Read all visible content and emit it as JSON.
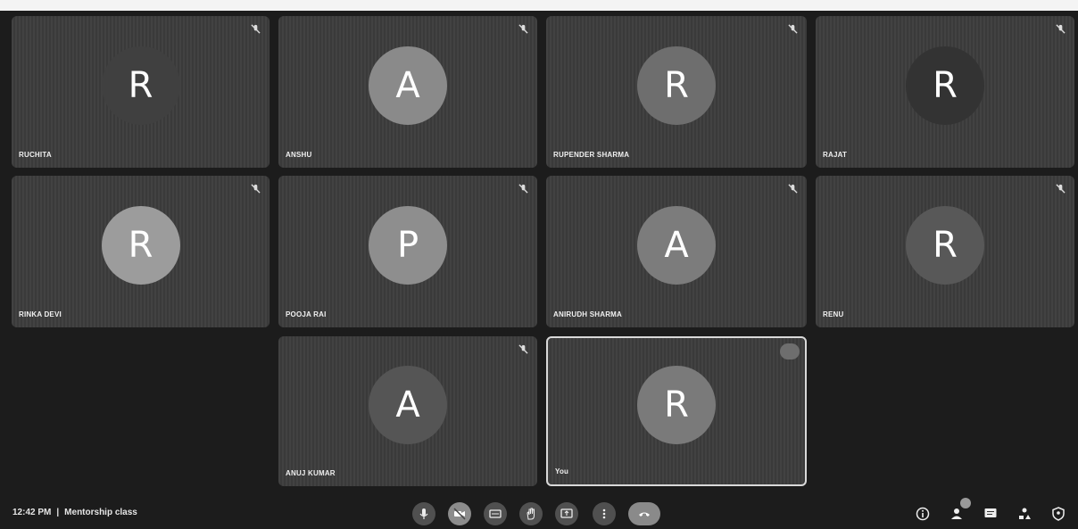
{
  "colors": {
    "tile_bg": "#3c3c3c",
    "background": "#1c1c1c",
    "control_bg": "#505050"
  },
  "participants": [
    {
      "initial": "R",
      "name": "RUCHITA",
      "avatar_color": "#404040",
      "mic": "muted"
    },
    {
      "initial": "A",
      "name": "ANSHU",
      "avatar_color": "#8a8a8a",
      "mic": "muted"
    },
    {
      "initial": "R",
      "name": "RUPENDER SHARMA",
      "avatar_color": "#6e6e6e",
      "mic": "muted"
    },
    {
      "initial": "R",
      "name": "RAJAT",
      "avatar_color": "#333333",
      "mic": "muted"
    },
    {
      "initial": "R",
      "name": "RINKA DEVI",
      "avatar_color": "#9c9c9c",
      "mic": "muted"
    },
    {
      "initial": "P",
      "name": "POOJA RAI",
      "avatar_color": "#8e8e8e",
      "mic": "muted"
    },
    {
      "initial": "A",
      "name": "ANIRUDH SHARMA",
      "avatar_color": "#7c7c7c",
      "mic": "muted"
    },
    {
      "initial": "R",
      "name": "RENU",
      "avatar_color": "#585858",
      "mic": "muted"
    },
    {
      "initial": "A",
      "name": "ANUJ KUMAR",
      "avatar_color": "#555555",
      "mic": "muted"
    },
    {
      "initial": "R",
      "name": "You",
      "avatar_color": "#7a7a7a",
      "mic": "speaking"
    }
  ],
  "meeting": {
    "time": "12:42 PM",
    "separator": "|",
    "title": "Mentorship class"
  },
  "controls": [
    "microphone-icon",
    "camera-off-icon",
    "captions-icon",
    "raise-hand-icon",
    "present-screen-icon",
    "more-options-icon",
    "end-call-icon"
  ],
  "right_controls": [
    "meeting-details-icon",
    "people-icon",
    "chat-icon",
    "activities-icon",
    "host-controls-icon"
  ]
}
